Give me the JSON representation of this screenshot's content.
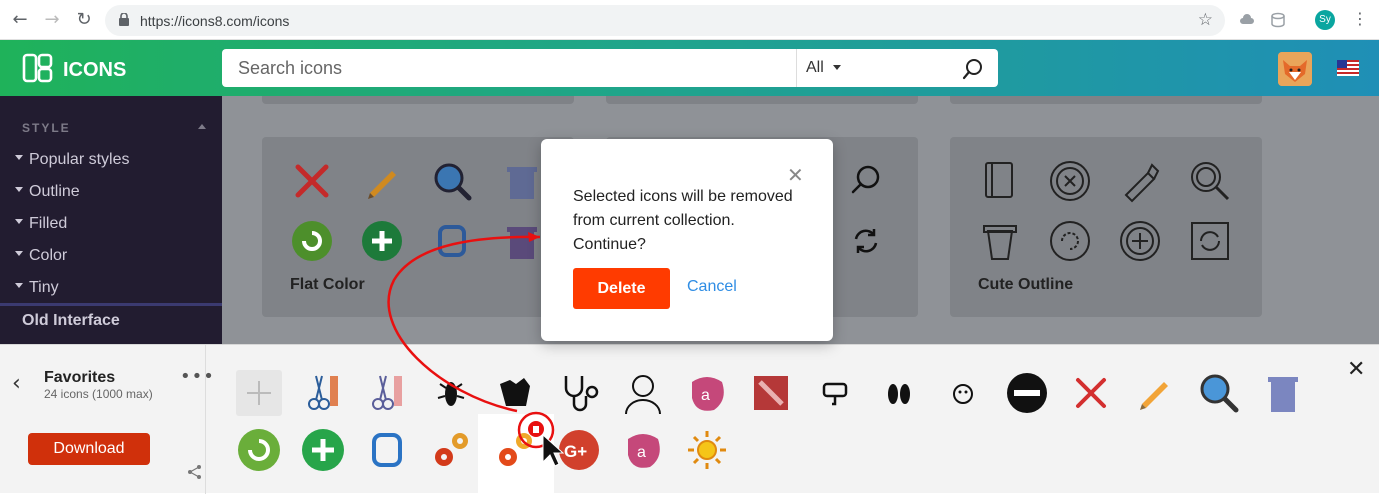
{
  "browser": {
    "url": "https://icons8.com/icons",
    "profile_initials": "Sy"
  },
  "appbar": {
    "brand": "ICONS",
    "search_placeholder": "Search icons",
    "filter": "All"
  },
  "sidebar": {
    "heading": "STYLE",
    "items": [
      "Popular styles",
      "Outline",
      "Filled",
      "Color",
      "Tiny"
    ],
    "old_interface": "Old Interface"
  },
  "cards": {
    "flat_color": "Flat Color",
    "cute_outline": "Cute Outline"
  },
  "dialog": {
    "message_line1": "Selected icons will be removed",
    "message_line2": "from current collection.",
    "message_line3": "Continue?",
    "delete_label": "Delete",
    "cancel_label": "Cancel"
  },
  "tray": {
    "title": "Favorites",
    "subtitle": "24 icons (1000 max)",
    "download_label": "Download"
  },
  "colors": {
    "accent_green": "#1fb25a",
    "delete_red": "#ff3b00",
    "download_red": "#d0300b",
    "link_blue": "#2f8de4",
    "sidebar_bg": "#221c30"
  }
}
